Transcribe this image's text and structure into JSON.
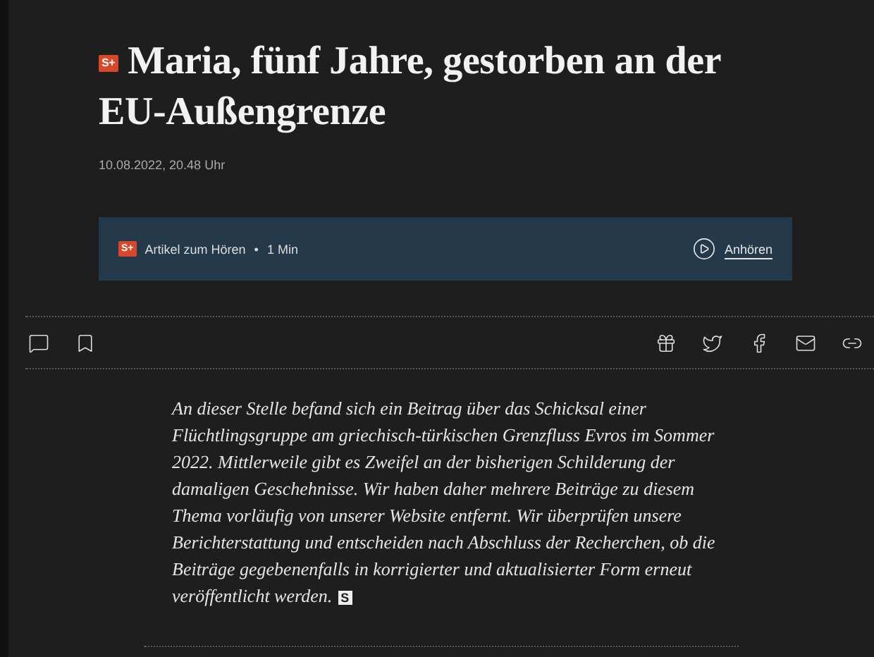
{
  "article": {
    "badge": "S+",
    "title": "Maria, fünf Jahre, gestorben an der EU-Außengrenze",
    "date": "10.08.2022, 20.48 Uhr"
  },
  "audio": {
    "badge": "S+",
    "label": "Artikel zum Hören",
    "separator": "•",
    "duration": "1 Min",
    "action": "Anhören"
  },
  "notice": {
    "text": "An dieser Stelle befand sich ein Beitrag über das Schicksal einer Flüchtlingsgruppe am griechisch-türkischen Grenzfluss Evros im Sommer 2022. Mittlerweile gibt es Zweifel an der bisherigen Schilderung der damaligen Geschehnisse. Wir haben daher mehrere Beiträge zu diesem Thema vorläufig von unserer Website entfernt. Wir überprüfen unsere Berichterstattung und entscheiden nach Abschluss der Recherchen, ob die Beiträge gegebenenfalls in korrigierter und aktualisierter Form erneut veröffentlicht werden.",
    "end_mark": "S"
  }
}
